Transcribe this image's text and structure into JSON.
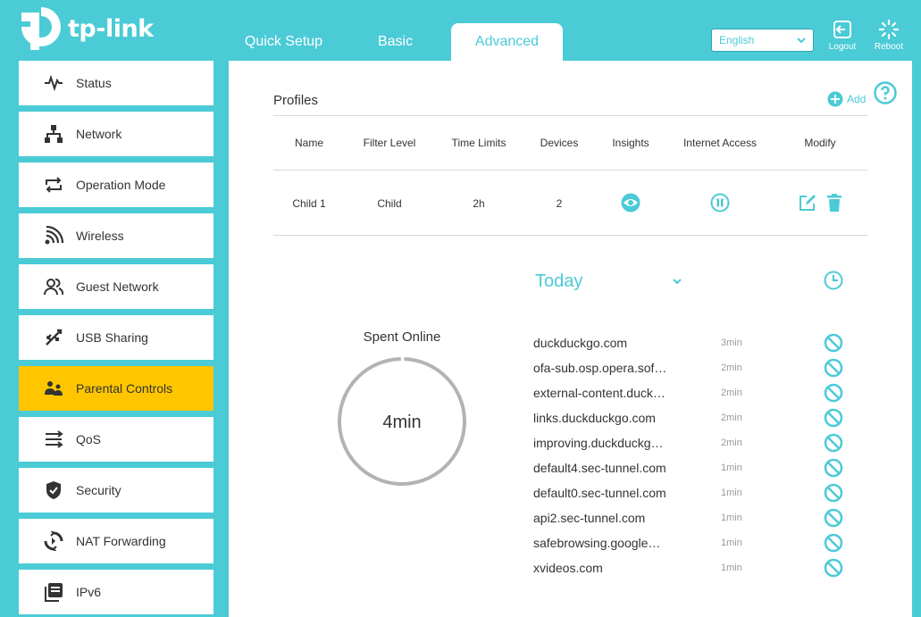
{
  "brand": {
    "logo_text": "tp-link"
  },
  "header": {
    "tabs": [
      {
        "label": "Quick Setup"
      },
      {
        "label": "Basic"
      },
      {
        "label": "Advanced",
        "active": true
      }
    ],
    "language": "English",
    "logout_label": "Logout",
    "reboot_label": "Reboot"
  },
  "sidebar": {
    "items": [
      {
        "label": "Status",
        "icon": "pulse-icon"
      },
      {
        "label": "Network",
        "icon": "network-icon"
      },
      {
        "label": "Operation Mode",
        "icon": "operation-mode-icon"
      },
      {
        "label": "Wireless",
        "icon": "wireless-icon"
      },
      {
        "label": "Guest Network",
        "icon": "guest-network-icon"
      },
      {
        "label": "USB Sharing",
        "icon": "usb-icon"
      },
      {
        "label": "Parental Controls",
        "icon": "parental-controls-icon",
        "active": true
      },
      {
        "label": "QoS",
        "icon": "qos-icon"
      },
      {
        "label": "Security",
        "icon": "shield-icon"
      },
      {
        "label": "NAT Forwarding",
        "icon": "nat-forwarding-icon"
      },
      {
        "label": "IPv6",
        "icon": "ipv6-icon"
      }
    ]
  },
  "profiles": {
    "title": "Profiles",
    "add_label": "Add",
    "columns": [
      "Name",
      "Filter Level",
      "Time Limits",
      "Devices",
      "Insights",
      "Internet Access",
      "Modify"
    ],
    "rows": [
      {
        "name": "Child 1",
        "filter_level": "Child",
        "time_limits": "2h",
        "devices": "2"
      }
    ]
  },
  "insights": {
    "period": "Today",
    "spent_label": "Spent Online",
    "spent_value": "4min",
    "sites": [
      {
        "name": "duckduckgo.com",
        "time": "3min"
      },
      {
        "name": "ofa-sub.osp.opera.sof…",
        "time": "2min"
      },
      {
        "name": "external-content.duck…",
        "time": "2min"
      },
      {
        "name": "links.duckduckgo.com",
        "time": "2min"
      },
      {
        "name": "improving.duckduckg…",
        "time": "2min"
      },
      {
        "name": "default4.sec-tunnel.com",
        "time": "1min"
      },
      {
        "name": "default0.sec-tunnel.com",
        "time": "1min"
      },
      {
        "name": "api2.sec-tunnel.com",
        "time": "1min"
      },
      {
        "name": "safebrowsing.google…",
        "time": "1min"
      },
      {
        "name": "xvideos.com",
        "time": "1min"
      }
    ]
  },
  "colors": {
    "accent": "#4acbd6",
    "active_nav": "#ffc600",
    "ring": "#b3b3b3"
  }
}
